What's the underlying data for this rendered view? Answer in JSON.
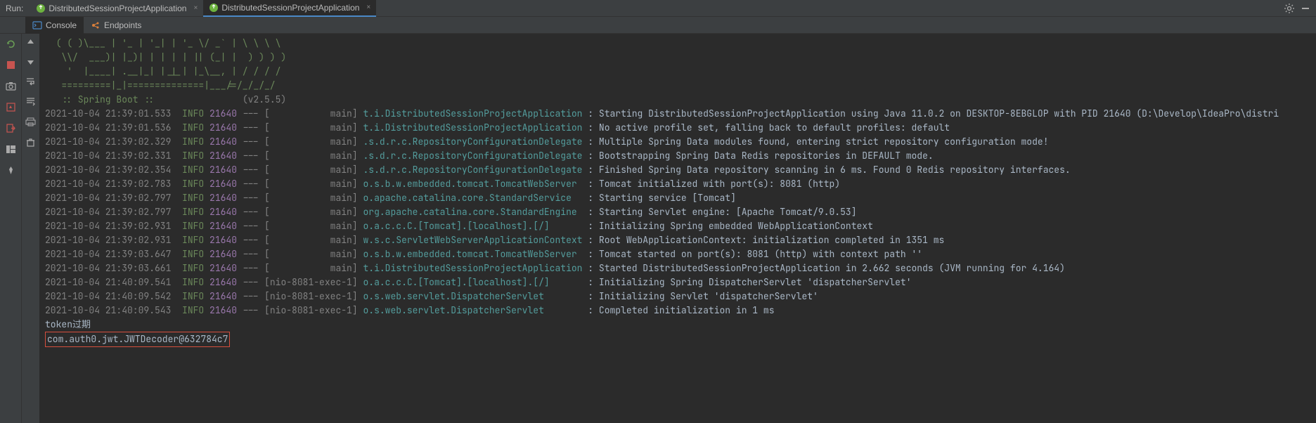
{
  "topbar": {
    "run_label": "Run:",
    "tabs": [
      {
        "name": "DistributedSessionProjectApplication",
        "active": false
      },
      {
        "name": "DistributedSessionProjectApplication",
        "active": true
      }
    ]
  },
  "subbar": {
    "console_label": "Console",
    "endpoints_label": "Endpoints"
  },
  "ascii": {
    "l1": "  ( ( )\\___ | '_ | '_| | '_ \\/ _` | \\ \\ \\ \\",
    "l2": "   \\\\/  ___)| |_)| | | | | || (_| |  ) ) ) )",
    "l3": "    '  |____| .__|_| |_|_| |_\\__, | / / / /",
    "l4": "   =========|_|==============|___/=/_/_/_/",
    "l5": "   :: Spring Boot ::                (v2.5.5)"
  },
  "logs": [
    {
      "ts": "2021-10-04 21:39:01.533",
      "lvl": "INFO",
      "pid": "21640",
      "sep": "--- [",
      "thread": "           main]",
      "logger": "t.i.DistributedSessionProjectApplication",
      "msg": ": Starting DistributedSessionProjectApplication using Java 11.0.2 on DESKTOP-8EBGLOP with PID 21640 (D:\\Develop\\IdeaPro\\distri"
    },
    {
      "ts": "2021-10-04 21:39:01.536",
      "lvl": "INFO",
      "pid": "21640",
      "sep": "--- [",
      "thread": "           main]",
      "logger": "t.i.DistributedSessionProjectApplication",
      "msg": ": No active profile set, falling back to default profiles: default"
    },
    {
      "ts": "2021-10-04 21:39:02.329",
      "lvl": "INFO",
      "pid": "21640",
      "sep": "--- [",
      "thread": "           main]",
      "logger": ".s.d.r.c.RepositoryConfigurationDelegate",
      "msg": ": Multiple Spring Data modules found, entering strict repository configuration mode!"
    },
    {
      "ts": "2021-10-04 21:39:02.331",
      "lvl": "INFO",
      "pid": "21640",
      "sep": "--- [",
      "thread": "           main]",
      "logger": ".s.d.r.c.RepositoryConfigurationDelegate",
      "msg": ": Bootstrapping Spring Data Redis repositories in DEFAULT mode."
    },
    {
      "ts": "2021-10-04 21:39:02.354",
      "lvl": "INFO",
      "pid": "21640",
      "sep": "--- [",
      "thread": "           main]",
      "logger": ".s.d.r.c.RepositoryConfigurationDelegate",
      "msg": ": Finished Spring Data repository scanning in 6 ms. Found 0 Redis repository interfaces."
    },
    {
      "ts": "2021-10-04 21:39:02.783",
      "lvl": "INFO",
      "pid": "21640",
      "sep": "--- [",
      "thread": "           main]",
      "logger": "o.s.b.w.embedded.tomcat.TomcatWebServer ",
      "msg": ": Tomcat initialized with port(s): 8081 (http)"
    },
    {
      "ts": "2021-10-04 21:39:02.797",
      "lvl": "INFO",
      "pid": "21640",
      "sep": "--- [",
      "thread": "           main]",
      "logger": "o.apache.catalina.core.StandardService  ",
      "msg": ": Starting service [Tomcat]"
    },
    {
      "ts": "2021-10-04 21:39:02.797",
      "lvl": "INFO",
      "pid": "21640",
      "sep": "--- [",
      "thread": "           main]",
      "logger": "org.apache.catalina.core.StandardEngine ",
      "msg": ": Starting Servlet engine: [Apache Tomcat/9.0.53]"
    },
    {
      "ts": "2021-10-04 21:39:02.931",
      "lvl": "INFO",
      "pid": "21640",
      "sep": "--- [",
      "thread": "           main]",
      "logger": "o.a.c.c.C.[Tomcat].[localhost].[/]      ",
      "msg": ": Initializing Spring embedded WebApplicationContext"
    },
    {
      "ts": "2021-10-04 21:39:02.931",
      "lvl": "INFO",
      "pid": "21640",
      "sep": "--- [",
      "thread": "           main]",
      "logger": "w.s.c.ServletWebServerApplicationContext",
      "msg": ": Root WebApplicationContext: initialization completed in 1351 ms"
    },
    {
      "ts": "2021-10-04 21:39:03.647",
      "lvl": "INFO",
      "pid": "21640",
      "sep": "--- [",
      "thread": "           main]",
      "logger": "o.s.b.w.embedded.tomcat.TomcatWebServer ",
      "msg": ": Tomcat started on port(s): 8081 (http) with context path ''"
    },
    {
      "ts": "2021-10-04 21:39:03.661",
      "lvl": "INFO",
      "pid": "21640",
      "sep": "--- [",
      "thread": "           main]",
      "logger": "t.i.DistributedSessionProjectApplication",
      "msg": ": Started DistributedSessionProjectApplication in 2.662 seconds (JVM running for 4.164)"
    },
    {
      "ts": "2021-10-04 21:40:09.541",
      "lvl": "INFO",
      "pid": "21640",
      "sep": "--- [",
      "thread": "nio-8081-exec-1]",
      "logger": "o.a.c.c.C.[Tomcat].[localhost].[/]      ",
      "msg": ": Initializing Spring DispatcherServlet 'dispatcherServlet'"
    },
    {
      "ts": "2021-10-04 21:40:09.542",
      "lvl": "INFO",
      "pid": "21640",
      "sep": "--- [",
      "thread": "nio-8081-exec-1]",
      "logger": "o.s.web.servlet.DispatcherServlet       ",
      "msg": ": Initializing Servlet 'dispatcherServlet'"
    },
    {
      "ts": "2021-10-04 21:40:09.543",
      "lvl": "INFO",
      "pid": "21640",
      "sep": "--- [",
      "thread": "nio-8081-exec-1]",
      "logger": "o.s.web.servlet.DispatcherServlet       ",
      "msg": ": Completed initialization in 1 ms"
    }
  ],
  "trailing": {
    "token_line": "token过期",
    "jwt_line": "com.auth0.jwt.JWTDecoder@632784c7"
  }
}
